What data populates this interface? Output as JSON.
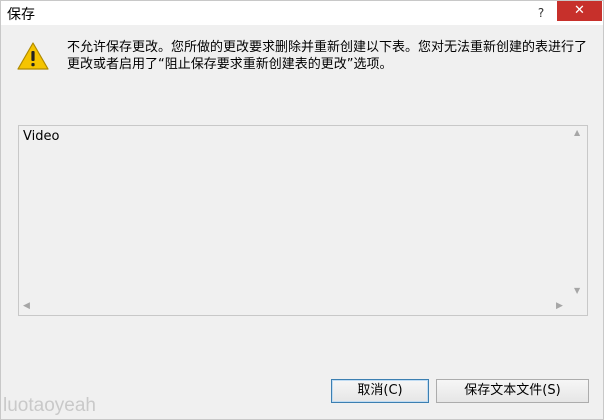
{
  "window": {
    "title": "保存",
    "help_label": "?",
    "close_label": "✕"
  },
  "dialog": {
    "message": "不允许保存更改。您所做的更改要求删除并重新创建以下表。您对无法重新创建的表进行了更改或者启用了“阻止保存要求重新创建表的更改”选项。",
    "icon": "warning-icon"
  },
  "list": {
    "items": [
      "Video"
    ]
  },
  "buttons": {
    "cancel": "取消(C)",
    "save_text_file": "保存文本文件(S)"
  },
  "watermark": "luotaoyeah"
}
